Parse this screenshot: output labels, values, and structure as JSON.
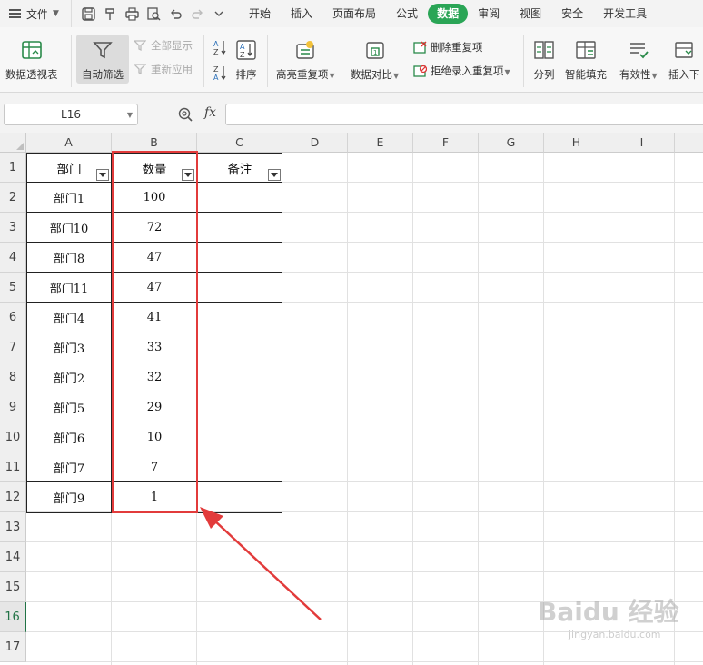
{
  "menubar": {
    "file_label": "文件",
    "tabs": [
      {
        "label": "开始",
        "active": false
      },
      {
        "label": "插入",
        "active": false
      },
      {
        "label": "页面布局",
        "active": false
      },
      {
        "label": "公式",
        "active": false
      },
      {
        "label": "数据",
        "active": true
      },
      {
        "label": "审阅",
        "active": false
      },
      {
        "label": "视图",
        "active": false
      },
      {
        "label": "安全",
        "active": false
      },
      {
        "label": "开发工具",
        "active": false
      }
    ],
    "quick_icons": [
      "save-icon",
      "format-painter-icon",
      "print-icon",
      "print-preview-icon",
      "undo-icon",
      "redo-icon",
      "customize-icon"
    ],
    "accent_color": "#2aa556"
  },
  "ribbon": {
    "pivot_table": "数据透视表",
    "auto_filter": "自动筛选",
    "show_all": "全部显示",
    "reapply": "重新应用",
    "sort": "排序",
    "highlight_duplicates": "高亮重复项",
    "data_compare": "数据对比",
    "remove_duplicates": "删除重复项",
    "reject_duplicates": "拒绝录入重复项",
    "split_column": "分列",
    "smart_fill": "智能填充",
    "validity": "有效性",
    "insert_dropdown": "插入下"
  },
  "formula_bar": {
    "name_box": "L16",
    "fx_label": "fx",
    "formula": ""
  },
  "sheet": {
    "columns": [
      "A",
      "B",
      "C",
      "D",
      "E",
      "F",
      "G",
      "H",
      "I"
    ],
    "rows": [
      "1",
      "2",
      "3",
      "4",
      "5",
      "6",
      "7",
      "8",
      "9",
      "10",
      "11",
      "12",
      "13",
      "14",
      "15",
      "16",
      "17"
    ],
    "selected_row": "16",
    "headers": {
      "a": "部门",
      "b": "数量",
      "c": "备注"
    },
    "data": [
      {
        "dept": "部门1",
        "qty": "100"
      },
      {
        "dept": "部门10",
        "qty": "72"
      },
      {
        "dept": "部门8",
        "qty": "47"
      },
      {
        "dept": "部门11",
        "qty": "47"
      },
      {
        "dept": "部门4",
        "qty": "41"
      },
      {
        "dept": "部门3",
        "qty": "33"
      },
      {
        "dept": "部门2",
        "qty": "32"
      },
      {
        "dept": "部门5",
        "qty": "29"
      },
      {
        "dept": "部门6",
        "qty": "10"
      },
      {
        "dept": "部门7",
        "qty": "7"
      },
      {
        "dept": "部门9",
        "qty": "1"
      }
    ],
    "highlight_color": "#e23b3b"
  },
  "watermark": {
    "logo": "Baidu 经验",
    "url": "jingyan.baidu.com"
  }
}
